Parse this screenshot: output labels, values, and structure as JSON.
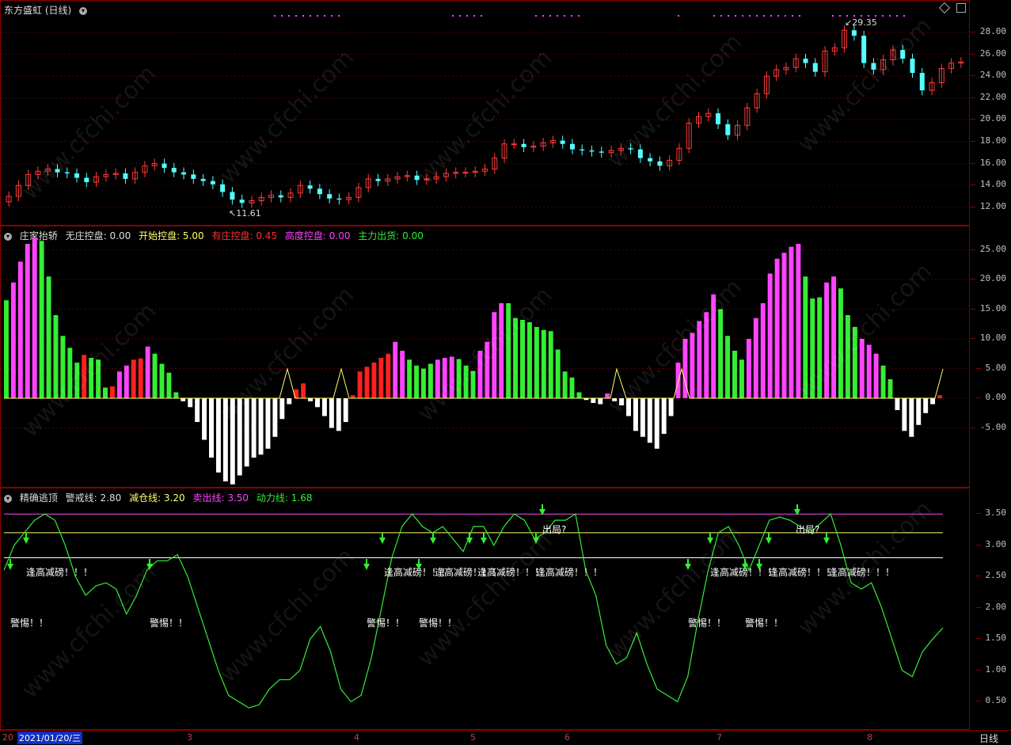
{
  "panel1": {
    "title": "东方盛虹 (日线)",
    "high_label": "29.35",
    "low_label": "11.61",
    "y_ticks": [
      "28.00",
      "26.00",
      "24.00",
      "22.00",
      "20.00",
      "18.00",
      "16.00",
      "14.00",
      "12.00"
    ]
  },
  "panel2": {
    "title": "庄家抬轿",
    "items": [
      {
        "label": "无庄控盘: 0.00",
        "color": "#dddddd"
      },
      {
        "label": "开始控盘: 5.00",
        "color": "#ffff66"
      },
      {
        "label": "有庄控盘: 0.45",
        "color": "#ff3030"
      },
      {
        "label": "高度控盘: 0.00",
        "color": "#ff44ff"
      },
      {
        "label": "主力出货: 0.00",
        "color": "#33ee33"
      }
    ],
    "y_ticks": [
      "25.00",
      "20.00",
      "15.00",
      "10.00",
      "5.00",
      "0.00",
      "-5.00"
    ]
  },
  "panel3": {
    "title": "精确逃顶",
    "items": [
      {
        "label": "警戒线: 2.80",
        "color": "#dddddd"
      },
      {
        "label": "减仓线: 3.20",
        "color": "#ffff66"
      },
      {
        "label": "卖出线: 3.50",
        "color": "#ff44ff"
      },
      {
        "label": "动力线: 1.68",
        "color": "#33ee33"
      }
    ],
    "y_ticks": [
      "3.50",
      "3.00",
      "2.50",
      "2.00",
      "1.50",
      "1.00",
      "0.50"
    ],
    "annotations": {
      "escape": "出局?",
      "reduce": "逢高减磅！！！",
      "alert": "警惕！！"
    }
  },
  "xaxis": {
    "date_cursor": "2021/01/20/三",
    "first_label": "20",
    "months": [
      "3",
      "4",
      "5",
      "6",
      "7",
      "8"
    ],
    "period": "日线"
  },
  "watermark": "www.cfchi.com",
  "colors": {
    "up": "#ff3b3b",
    "down": "#54ffff",
    "grid": "#8b0000",
    "magenta": "#ff44ff",
    "green": "#33ee33",
    "red": "#ff2020",
    "white": "#ffffff"
  }
}
